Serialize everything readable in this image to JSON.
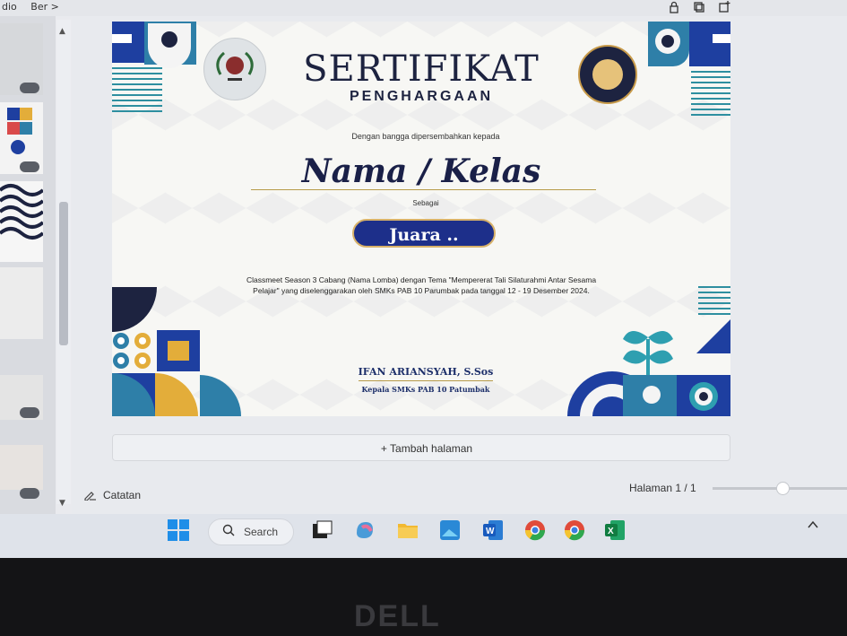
{
  "topbar": {
    "left_items": [
      "dio",
      "Ber >"
    ]
  },
  "certificate": {
    "title": "SERTIFIKAT",
    "subtitle": "PENGHARGAAN",
    "intro": "Dengan bangga dipersembahkan kepada",
    "name": "Nama / Kelas",
    "sebagai": "Sebagai",
    "juara": "Juara ..",
    "description_line1": "Classmeet Season 3 Cabang (Nama Lomba) dengan Tema \"Mempererat Tali Silaturahmi Antar Sesama",
    "description_line2": "Pelajar\" yang diselenggarakan oleh SMKs PAB 10 Parumbak pada tanggal 12 - 19 Desember 2024.",
    "signer_name": "IFAN ARIANSYAH, S.Sos",
    "signer_role": "Kepala SMKs PAB 10 Patumbak"
  },
  "editor": {
    "add_page": "+ Tambah halaman",
    "notes": "Catatan",
    "page_indicator": "Halaman 1 / 1"
  },
  "taskbar": {
    "search_label": "Search"
  },
  "bezel": {
    "brand": "DELL"
  },
  "colors": {
    "navy": "#1d2340",
    "blue": "#1e3fa0",
    "teal": "#2e7fa8",
    "gold": "#e3ad3a",
    "accent_line": "#b79b4a"
  }
}
